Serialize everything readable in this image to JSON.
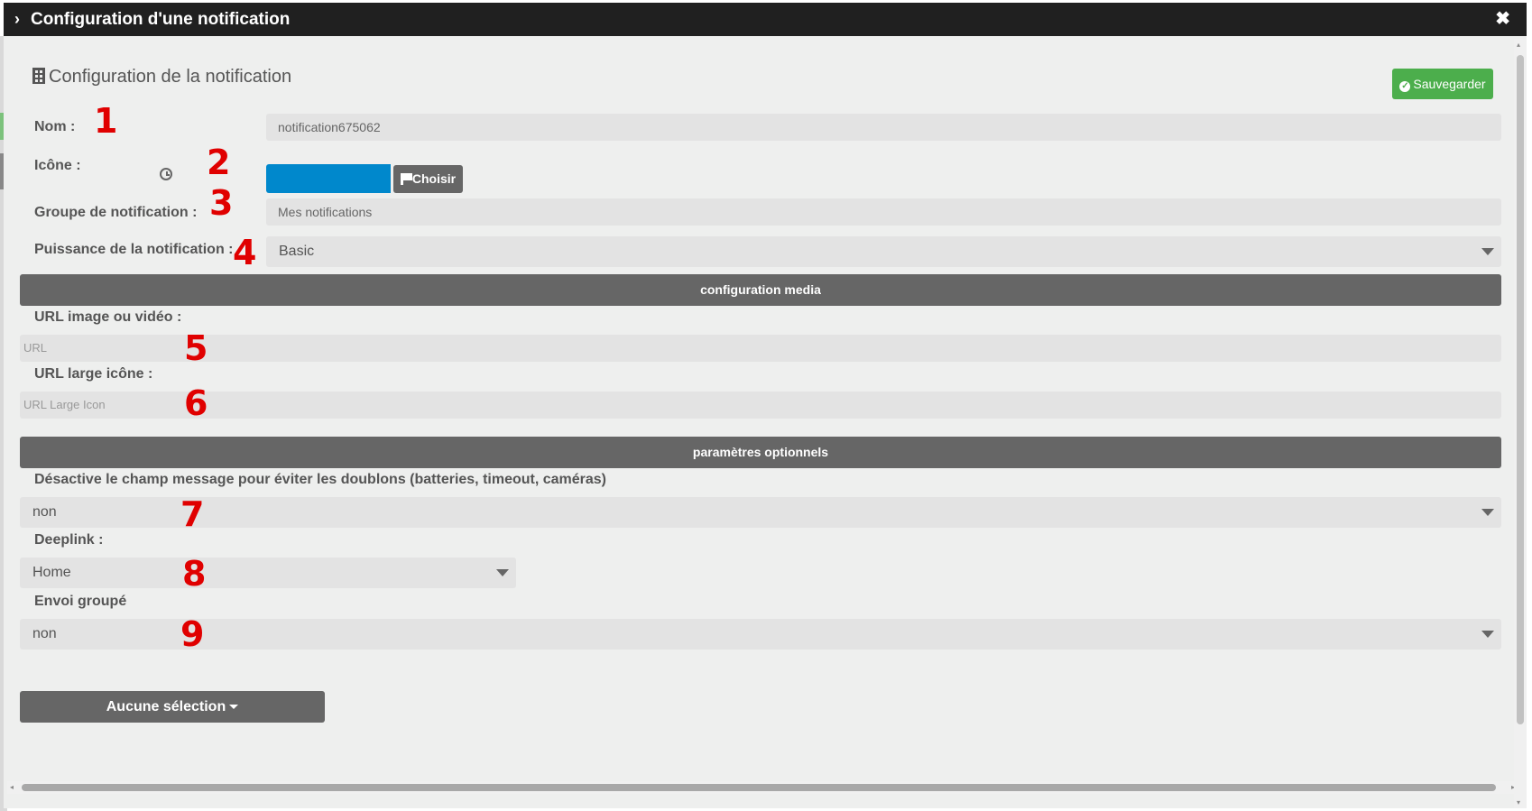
{
  "dialog": {
    "title": "Configuration d'une notification",
    "close_glyph": "✖",
    "expand_glyph": "›"
  },
  "section": {
    "title": "Configuration de la notification",
    "save_label": "Sauvegarder"
  },
  "form": {
    "nom_label": "Nom :",
    "nom_value": "notification675062",
    "icone_label": "Icône :",
    "icone_color": "#0088cc",
    "choisir_label": "Choisir",
    "groupe_label": "Groupe de notification :",
    "groupe_value": "Mes notifications",
    "puissance_label": "Puissance de la notification :",
    "puissance_value": "Basic"
  },
  "media": {
    "header": "configuration media",
    "url_label": "URL image ou vidéo :",
    "url_placeholder": "URL",
    "large_icon_label": "URL large icône :",
    "large_icon_placeholder": "URL Large Icon"
  },
  "optional": {
    "header": "paramètres optionnels",
    "desactive_label": "Désactive le champ message pour éviter les doublons (batteries, timeout, caméras)",
    "desactive_value": "non",
    "deeplink_label": "Deeplink :",
    "deeplink_value": "Home",
    "envoi_label": "Envoi groupé",
    "envoi_value": "non",
    "selection_label": "Aucune sélection"
  },
  "annotations": [
    "1",
    "2",
    "3",
    "4",
    "5",
    "6",
    "7",
    "8",
    "9"
  ],
  "colors": {
    "save_green": "#4cae4c",
    "bar_gray": "#666666",
    "annotation_red": "#e00000",
    "titlebar_dark": "#202020"
  }
}
